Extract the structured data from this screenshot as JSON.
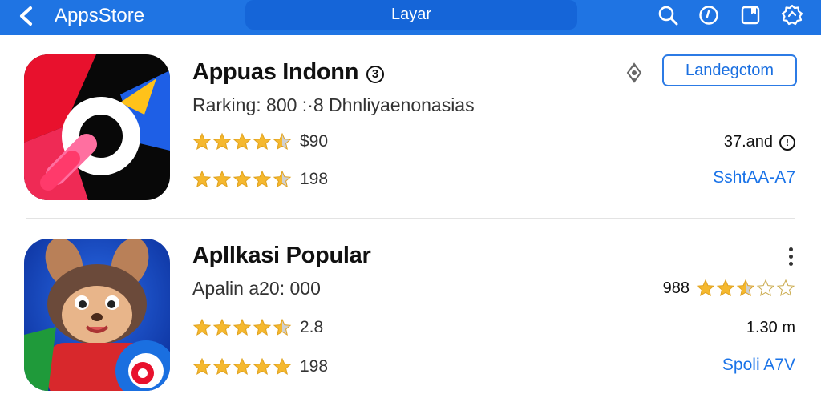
{
  "header": {
    "app_title": "AppsStore",
    "tab_label": "Layar",
    "icons": [
      "back-icon",
      "search-icon",
      "clock-icon",
      "bookmark-icon",
      "settings-icon"
    ]
  },
  "apps": [
    {
      "name": "Appuas Indonn",
      "name_badge": "3",
      "subtitle": "Rarking: 800 :·8 Dhnliyaenonasias",
      "rating1": {
        "stars": 4.5,
        "text": "$90"
      },
      "rating2": {
        "stars": 4.5,
        "text": "198"
      },
      "action_label": "Landegctom",
      "meta": "37.and",
      "meta_icon": "info-icon",
      "link": "SshtAA-A7"
    },
    {
      "name": "Apllkasi Popular",
      "subtitle": "Apalin a20:  000",
      "rating_right": {
        "stars": 2.5,
        "text": "988"
      },
      "rating1": {
        "stars": 4.5,
        "text": "2.8"
      },
      "rating2": {
        "stars": 5,
        "text": "198"
      },
      "meta": "1.30 m",
      "link": "Spoli A7V"
    }
  ],
  "colors": {
    "header_bg": "#1f74e3",
    "tab_bg": "#1565d8",
    "accent": "#1a73e8",
    "star": "#f5b82e",
    "star_empty": "#d0d0d0"
  }
}
